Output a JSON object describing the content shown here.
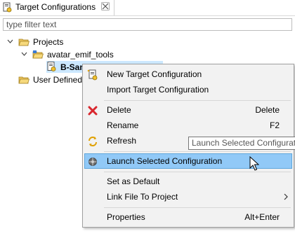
{
  "tab": {
    "title": "Target Configurations",
    "icon": "target-config-icon",
    "close_icon": "close-icon"
  },
  "filter": {
    "placeholder": "type filter text",
    "value": ""
  },
  "tree": {
    "projects_label": "Projects",
    "project_label": "avatar_emif_tools",
    "config_label": "B-Sample.ccxml [Default]",
    "user_defined_label": "User Defined"
  },
  "context_menu": {
    "items": [
      {
        "label": "New Target Configuration",
        "icon": "new-config-icon",
        "accelerator": ""
      },
      {
        "label": "Import Target Configuration",
        "icon": "",
        "accelerator": ""
      },
      {
        "label": "Delete",
        "icon": "delete-icon",
        "accelerator": "Delete"
      },
      {
        "label": "Rename",
        "icon": "",
        "accelerator": "F2"
      },
      {
        "label": "Refresh",
        "icon": "refresh-icon",
        "accelerator": ""
      },
      {
        "label": "Launch Selected Configuration",
        "icon": "launch-debug-icon",
        "accelerator": ""
      },
      {
        "label": "Set as Default",
        "icon": "",
        "accelerator": ""
      },
      {
        "label": "Link File To Project",
        "icon": "",
        "accelerator": "",
        "submenu": true
      },
      {
        "label": "Properties",
        "icon": "",
        "accelerator": "Alt+Enter"
      }
    ],
    "highlighted_item": "Launch Selected Configuration"
  },
  "tooltip": {
    "text": "Launch Selected Configuration"
  },
  "colors": {
    "selection": "#cce8ff",
    "menu_highlight": "#91c9f7",
    "menu_background": "#f2f2f2",
    "delete_red": "#d9272e"
  }
}
